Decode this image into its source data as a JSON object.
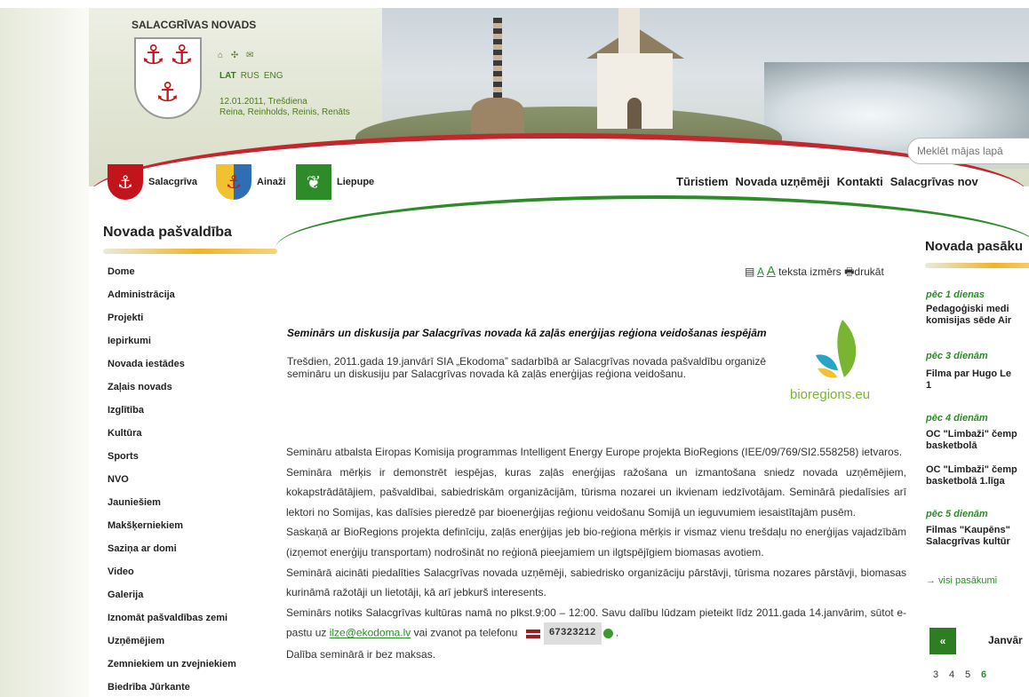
{
  "header": {
    "site_title": "SALACGRĪVAS NOVADS",
    "icons": "⌂ ✣ ✉",
    "languages": [
      "LAT",
      "RUS",
      "ENG"
    ],
    "date": "12.01.2011, Trešdiena",
    "namedays": "Reina, Reinholds, Reinis, Renāts",
    "search_placeholder": "Meklēt mājas lapā"
  },
  "towns": [
    {
      "label": "Salacgrīva"
    },
    {
      "label": "Ainaži"
    },
    {
      "label": "Liepupe"
    }
  ],
  "topnav": [
    "Tūristiem",
    "Novada uzņēmēji",
    "Kontakti",
    "Salacgrīvas nov"
  ],
  "sidebar": {
    "title": "Novada pašvaldība",
    "items": [
      "Dome",
      "Administrācija",
      "Projekti",
      "Iepirkumi",
      "Novada iestādes",
      "Zaļais novads",
      "Izglītība",
      "Kultūra",
      "Sports",
      "NVO",
      "Jauniešiem",
      "Makšķerniekiem",
      "Saziņa ar domi",
      "Video",
      "Galerija",
      "Iznomāt pašvaldības zemi",
      "Uzņēmējiem",
      "Zemniekiem un zvejniekiem",
      "Biedrība Jūrkante"
    ]
  },
  "tools": {
    "text_size_label": "teksta izmērs",
    "print_label": "drukāt"
  },
  "article": {
    "title": "Seminārs un diskusija par Salacgrīvas novada kā zaļās enerģijas reģiona veidošanas iespējām",
    "lead": "Trešdien, 2011.gada 19.janvārī SIA „Ekodoma” sadarbībā ar Salacgrīvas novada pašvaldību organizē semināru  un diskusiju par Salacgrīvas novada kā zaļās enerģijas reģiona veidošanu.",
    "logo_text": "bioregions.eu",
    "paragraphs": [
      "Semināru atbalsta Eiropas Komisija programmas Intelligent Energy Europe projekta BioRegions (IEE/09/769/SI2.558258) ietvaros.",
      "Semināra mērķis ir demonstrēt iespējas, kuras zaļās enerģijas ražošana un izmantošana sniedz novada uzņēmējiem, kokapstrādātājiem, pašvaldībai, sabiedriskām organizācijām, tūrisma nozarei un ikvienam iedzīvotājam. Seminārā piedalīsies arī lektori no Somijas, kas dalīsies pieredzē par bioenerģijas reģionu veidošanu Somijā un ieguvumiem iesaistītajām pusēm.",
      "Saskaņā ar BioRegions projekta definīciju, zaļās enerģijas jeb bio-reģiona mērķis ir vismaz vienu trešdaļu no enerģijas vajadzībām  (izņemot enerģiju transportam) nodrošināt no reģionā pieejamiem un ilgtspējīgiem biomasas avotiem.",
      "Seminārā aicināti piedalīties Salacgrīvas novada uzņēmēji, sabiedrisko organizāciju pārstāvji, tūrisma nozares pārstāvji, biomasas kurināmā ražotāji un lietotāji, kā arī jebkurš interesents."
    ],
    "contact_prefix": "Seminārs notiks Salacgrīvas kultūras namā no plkst.9:00 – 12:00. Savu dalību lūdzam pieteikt līdz 2011.gada 14.janvārim, sūtot e-pastu uz ",
    "email": "ilze@ekodoma.lv",
    "contact_mid": " vai zvanot pa telefonu ",
    "phone": "67323212",
    "contact_suffix": " .",
    "last_line": "Dalība seminārā ir bez maksas."
  },
  "events": {
    "title": "Novada pasāku",
    "groups": [
      {
        "when": "pēc 1 dienas",
        "items": [
          "Pedagoģiski medi\nkomisijas sēde Air"
        ]
      },
      {
        "when": "pēc 3 dienām",
        "items": [
          "Filma par Hugo Le\n1"
        ]
      },
      {
        "when": "pēc 4 dienām",
        "items": [
          "OC \"Limbaži\" čemp\nbasketbolā",
          "OC \"Limbaži\" čemp\nbasketbolā 1.līga"
        ]
      },
      {
        "when": "pēc 5 dienām",
        "items": [
          "Filmas \"Kaupēns\"\nSalacgrīvas kultūr"
        ]
      }
    ],
    "all_label": "→  visi pasākumi",
    "cal_prev": "«",
    "cal_month": "Janvār",
    "cal_days": [
      "3",
      "4",
      "5",
      "6"
    ],
    "today": "6"
  },
  "colors": {
    "accent_green": "#2e8b2a",
    "accent_red": "#c2272d",
    "accent_orange": "#f2b32a"
  }
}
